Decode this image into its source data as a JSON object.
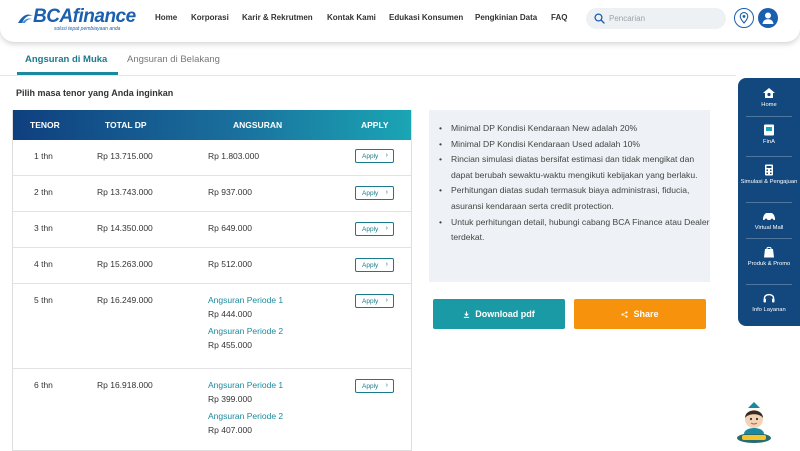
{
  "brand": {
    "logo_text": "BCAfinance",
    "tagline": "solusi tepat pembiayaan anda",
    "primary_color": "#1b5fae",
    "accent_teal": "#1a9aa5",
    "accent_orange": "#f7920d"
  },
  "nav": {
    "items": [
      {
        "label": "Home"
      },
      {
        "label": "Korporasi"
      },
      {
        "label": "Karir & Rekrutmen"
      },
      {
        "label": "Kontak Kami"
      },
      {
        "label": "Edukasi Konsumen"
      },
      {
        "label": "Pengkinian Data"
      },
      {
        "label": "FAQ"
      }
    ],
    "search_placeholder": "Pencarian"
  },
  "tabs": [
    {
      "label": "Angsuran di Muka",
      "active": true
    },
    {
      "label": "Angsuran di Belakang",
      "active": false
    }
  ],
  "section_title": "Pilih masa tenor yang Anda inginkan",
  "table": {
    "headers": {
      "tenor": "TENOR",
      "total_dp": "TOTAL DP",
      "angsuran": "ANGSURAN",
      "apply": "APPLY"
    },
    "apply_label": "Apply",
    "rows": [
      {
        "tenor": "1 thn",
        "total_dp": "Rp 13.715.000",
        "angsuran": "Rp 1.803.000"
      },
      {
        "tenor": "2 thn",
        "total_dp": "Rp 13.743.000",
        "angsuran": "Rp 937.000"
      },
      {
        "tenor": "3 thn",
        "total_dp": "Rp 14.350.000",
        "angsuran": "Rp 649.000"
      },
      {
        "tenor": "4 thn",
        "total_dp": "Rp 15.263.000",
        "angsuran": "Rp 512.000"
      },
      {
        "tenor": "5 thn",
        "total_dp": "Rp 16.249.000",
        "periods": [
          {
            "label": "Angsuran Periode 1",
            "value": "Rp 444.000"
          },
          {
            "label": "Angsuran Periode 2",
            "value": "Rp 455.000"
          }
        ]
      },
      {
        "tenor": "6 thn",
        "total_dp": "Rp 16.918.000",
        "periods": [
          {
            "label": "Angsuran Periode 1",
            "value": "Rp 399.000"
          },
          {
            "label": "Angsuran Periode 2",
            "value": "Rp 407.000"
          }
        ]
      }
    ]
  },
  "info": {
    "items": [
      "Minimal DP Kondisi Kendaraan New adalah 20%",
      "Minimal DP Kondisi Kendaraan Used adalah 10%",
      "Rincian simulasi diatas bersifat estimasi dan tidak mengikat dan dapat berubah sewaktu-waktu mengikuti kebijakan yang berlaku.",
      "Perhitungan diatas sudah termasuk biaya administrasi, fiducia, asuransi kendaraan serta credit protection.",
      "Untuk perhitungan detail, hubungi cabang BCA Finance atau Dealer terdekat."
    ]
  },
  "actions": {
    "download_label": "Download pdf",
    "share_label": "Share"
  },
  "sidebar": {
    "items": [
      {
        "label": "Home",
        "icon": "home-icon"
      },
      {
        "label": "FinA",
        "icon": "fina-icon"
      },
      {
        "label": "Simulasi & Pengajuan",
        "icon": "calculator-icon"
      },
      {
        "label": "Virtual Mall",
        "icon": "car-icon"
      },
      {
        "label": "Produk & Promo",
        "icon": "bag-icon"
      },
      {
        "label": "Info Layanan",
        "icon": "headset-icon"
      }
    ]
  },
  "mascot": {
    "icon": "mascot-icon"
  }
}
